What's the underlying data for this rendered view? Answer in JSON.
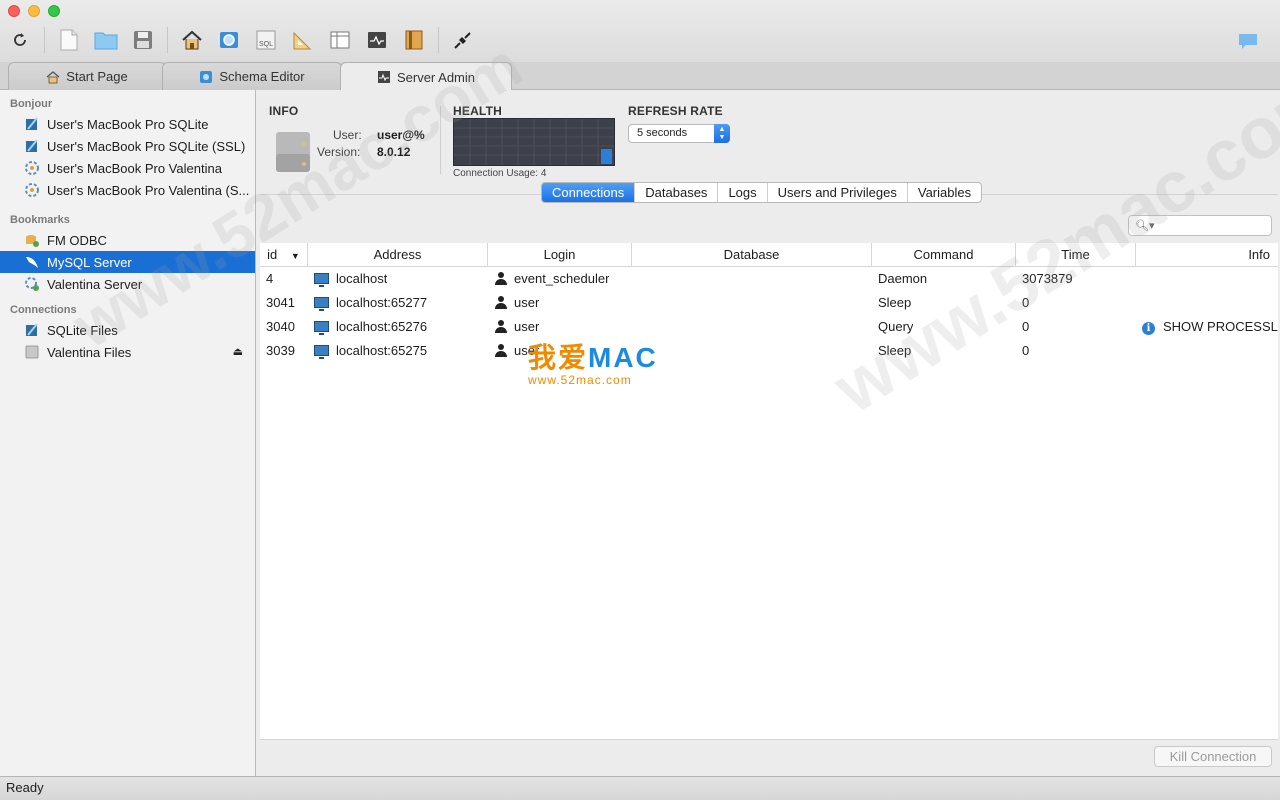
{
  "tabs": [
    {
      "label": "Start Page",
      "icon": "house-icon"
    },
    {
      "label": "Schema Editor",
      "icon": "schema-icon"
    },
    {
      "label": "Server Admin",
      "icon": "activity-icon"
    }
  ],
  "sidebar": {
    "sections": [
      {
        "header": "Bonjour",
        "items": [
          {
            "label": "User's MacBook Pro SQLite",
            "icon": "sqlite-icon"
          },
          {
            "label": "User's MacBook Pro SQLite (SSL)",
            "icon": "sqlite-icon"
          },
          {
            "label": "User's MacBook Pro Valentina",
            "icon": "valentina-icon"
          },
          {
            "label": "User's MacBook Pro Valentina (S...",
            "icon": "valentina-icon"
          }
        ]
      },
      {
        "header": "Bookmarks",
        "items": [
          {
            "label": "FM ODBC",
            "icon": "odbc-icon"
          },
          {
            "label": "MySQL Server",
            "icon": "mysql-icon",
            "selected": true
          },
          {
            "label": "Valentina Server",
            "icon": "valentina-server-icon"
          }
        ]
      },
      {
        "header": "Connections",
        "items": [
          {
            "label": "SQLite Files",
            "icon": "sqlite-icon"
          },
          {
            "label": "Valentina Files",
            "icon": "drive-icon",
            "eject": "⏏"
          }
        ]
      }
    ]
  },
  "info": {
    "heading": "INFO",
    "user_label": "User:",
    "user_value": "user@%",
    "version_label": "Version:",
    "version_value": "8.0.12"
  },
  "health": {
    "heading": "HEALTH",
    "connection_usage": "Connection Usage: 4",
    "usage_level": 0.35
  },
  "refresh": {
    "heading": "REFRESH RATE",
    "selected": "5 seconds"
  },
  "segments": [
    {
      "label": "Connections",
      "active": true
    },
    {
      "label": "Databases"
    },
    {
      "label": "Logs"
    },
    {
      "label": "Users and Privileges"
    },
    {
      "label": "Variables"
    }
  ],
  "search": {
    "placeholder": ""
  },
  "table": {
    "columns": [
      "id",
      "Address",
      "Login",
      "Database",
      "Command",
      "Time",
      "Info"
    ],
    "rows": [
      {
        "id": "4",
        "address": "localhost",
        "login": "event_scheduler",
        "database": "",
        "command": "Daemon",
        "time": "3073879",
        "info": ""
      },
      {
        "id": "3041",
        "address": "localhost:65277",
        "login": "user",
        "database": "",
        "command": "Sleep",
        "time": "0",
        "info": ""
      },
      {
        "id": "3040",
        "address": "localhost:65276",
        "login": "user",
        "database": "",
        "command": "Query",
        "time": "0",
        "info": "SHOW PROCESSLIST"
      },
      {
        "id": "3039",
        "address": "localhost:65275",
        "login": "user",
        "database": "",
        "command": "Sleep",
        "time": "0",
        "info": ""
      }
    ]
  },
  "kill_button": "Kill Connection",
  "status": "Ready",
  "watermark": {
    "logo_main": "我爱",
    "logo_mac": "MAC",
    "logo_url": "www.52mac.com",
    "diagonal": "www.52mac.com"
  },
  "colors": {
    "accent": "#1a6fd4",
    "health_bg": "#3d3f4b",
    "health_bar": "#2a7fd6"
  }
}
